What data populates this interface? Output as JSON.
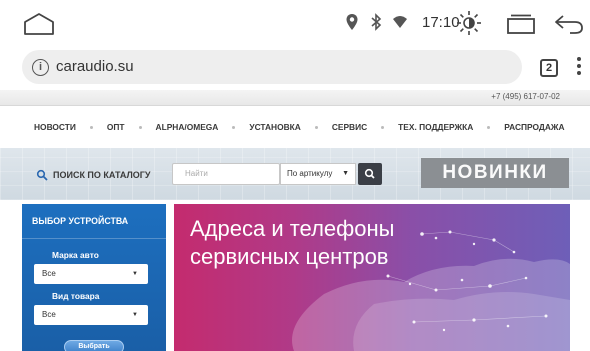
{
  "status_bar": {
    "time": "17:10",
    "icons": [
      "home-outline-icon",
      "location-icon",
      "bluetooth-icon",
      "wifi-icon",
      "brightness-icon",
      "recent-apps-icon",
      "back-icon"
    ]
  },
  "browser": {
    "url": "caraudio.su",
    "tab_count": "2"
  },
  "site": {
    "phone": "+7 (495) 617-07-02",
    "nav": [
      "НОВОСТИ",
      "ОПТ",
      "ALPHA/OMEGA",
      "УСТАНОВКА",
      "СЕРВИС",
      "ТЕХ. ПОДДЕРЖКА",
      "РАСПРОДАЖА"
    ],
    "search": {
      "label": "ПОИСК ПО КАТАЛОГУ",
      "placeholder": "Найти",
      "mode": "По артикулу"
    },
    "new_button": "НОВИНКИ",
    "sidebar": {
      "title": "ВЫБОР УСТРОЙСТВА",
      "brand_label": "Марка авто",
      "brand_value": "Все",
      "type_label": "Вид товара",
      "type_value": "Все",
      "submit": "Выбрать"
    },
    "banner": {
      "line1": "Адреса и телефоны",
      "line2": "сервисных центров"
    }
  },
  "colors": {
    "sidebar_blue": "#1d6fbf",
    "banner_pink": "#c42b6e",
    "banner_violet": "#6e5fb8",
    "novinki_gray": "#8b8f93"
  }
}
